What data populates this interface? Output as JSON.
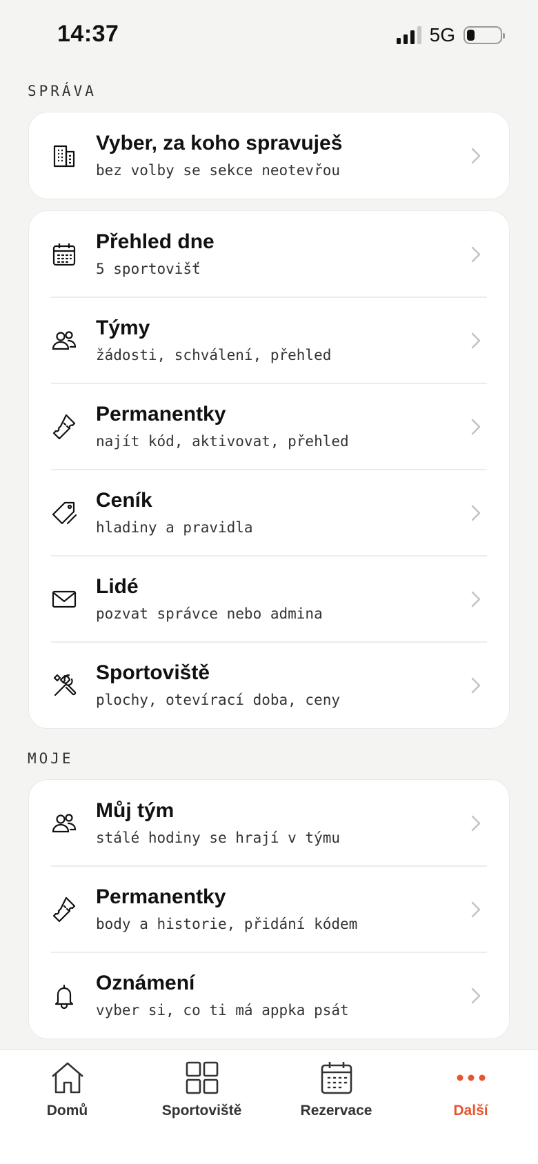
{
  "status": {
    "time": "14:37",
    "network": "5G"
  },
  "sections": [
    {
      "label": "SPRÁVA"
    },
    {
      "label": "MOJE"
    }
  ],
  "cards": {
    "select": [
      {
        "title": "Vyber, za koho spravuješ",
        "subtitle": "bez volby se sekce neotevřou",
        "icon": "building-icon"
      }
    ],
    "manage": [
      {
        "title": "Přehled dne",
        "subtitle": "5 sportovišť",
        "icon": "calendar-icon"
      },
      {
        "title": "Týmy",
        "subtitle": "žádosti, schválení, přehled",
        "icon": "people-icon"
      },
      {
        "title": "Permanentky",
        "subtitle": "najít kód, aktivovat, přehled",
        "icon": "ticket-icon"
      },
      {
        "title": "Ceník",
        "subtitle": "hladiny a pravidla",
        "icon": "tag-icon"
      },
      {
        "title": "Lidé",
        "subtitle": "pozvat správce nebo admina",
        "icon": "mail-icon"
      },
      {
        "title": "Sportoviště",
        "subtitle": "plochy, otevírací doba, ceny",
        "icon": "tools-icon"
      }
    ],
    "mine": [
      {
        "title": "Můj tým",
        "subtitle": "stálé hodiny se hrají v týmu",
        "icon": "people-icon"
      },
      {
        "title": "Permanentky",
        "subtitle": "body a historie, přidání kódem",
        "icon": "ticket-icon"
      },
      {
        "title": "Oznámení",
        "subtitle": "vyber si, co ti má appka psát",
        "icon": "bell-icon"
      }
    ]
  },
  "tabbar": [
    {
      "label": "Domů",
      "icon": "home-icon",
      "active": false
    },
    {
      "label": "Sportoviště",
      "icon": "grid-icon",
      "active": false
    },
    {
      "label": "Rezervace",
      "icon": "calendar-icon",
      "active": false
    },
    {
      "label": "Další",
      "icon": "more-icon",
      "active": true
    }
  ],
  "colors": {
    "accent": "#e4572e",
    "background": "#f4f4f3",
    "card": "#ffffff"
  }
}
